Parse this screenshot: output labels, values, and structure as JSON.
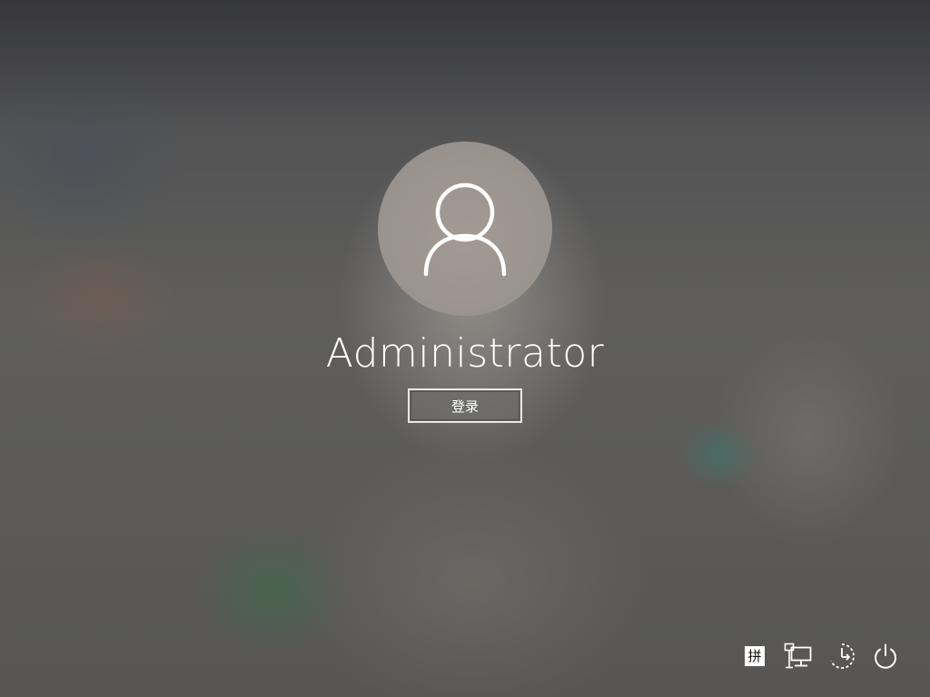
{
  "user": {
    "name": "Administrator",
    "avatar_icon": "user-silhouette-icon"
  },
  "signin": {
    "label": "登录"
  },
  "tray": {
    "ime_label": "拼",
    "network_icon": "network-icon",
    "ease_of_access_icon": "ease-of-access-icon",
    "power_icon": "power-icon"
  },
  "colors": {
    "text": "#ffffff",
    "avatar_bg": "#9a938e",
    "button_border": "#e6e6e6"
  }
}
